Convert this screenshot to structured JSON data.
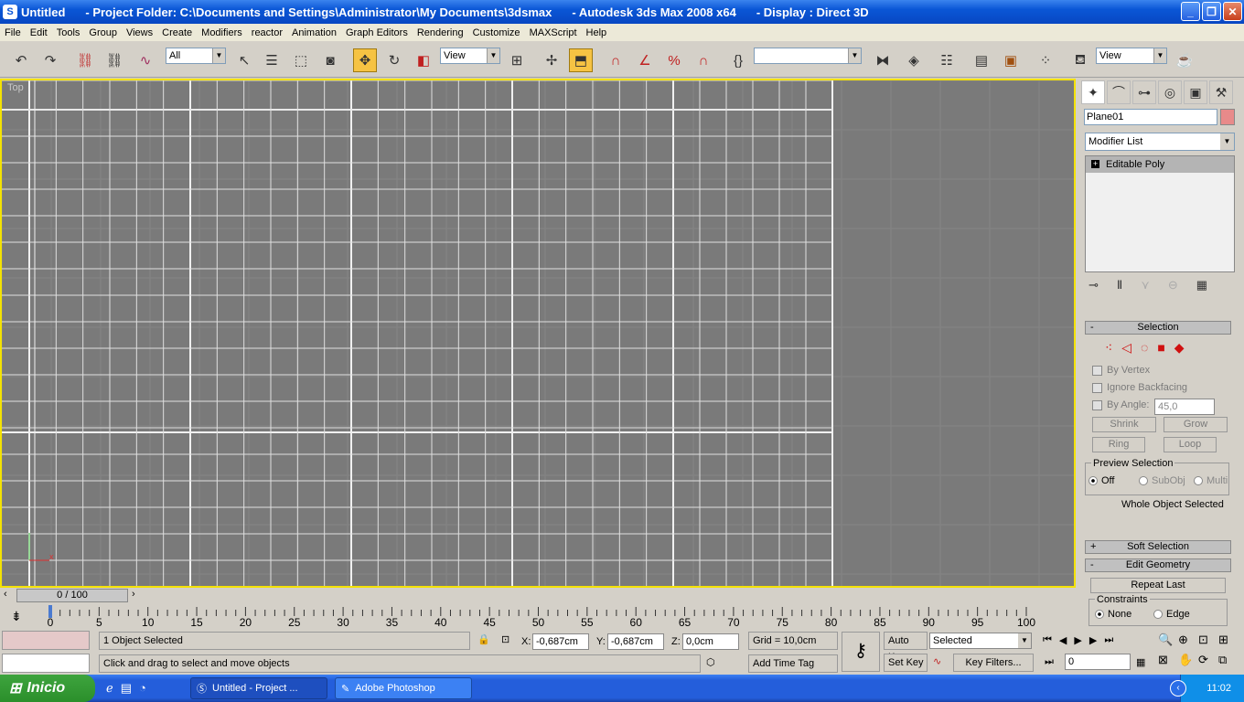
{
  "titlebar": {
    "doc": "Untitled",
    "folder": "- Project Folder: C:\\Documents and Settings\\Administrator\\My Documents\\3dsmax",
    "app": "- Autodesk 3ds Max 2008 x64",
    "display": "- Display : Direct 3D",
    "min": "_",
    "max": "❐",
    "close": "✕"
  },
  "menu": [
    "File",
    "Edit",
    "Tools",
    "Group",
    "Views",
    "Create",
    "Modifiers",
    "reactor",
    "Animation",
    "Graph Editors",
    "Rendering",
    "Customize",
    "MAXScript",
    "Help"
  ],
  "toolbar": {
    "filter": "All",
    "refcoord": "View",
    "selset": "",
    "viewrender": "View"
  },
  "viewport": {
    "label": "Top"
  },
  "cmd": {
    "objname": "Plane01",
    "modlist": "Modifier List",
    "stack_item": "Editable Poly",
    "stack_plus": "+",
    "sel_header": "Selection",
    "sel_sign": "-",
    "by_vertex": "By Vertex",
    "ignore_back": "Ignore Backfacing",
    "by_angle": "By Angle:",
    "angle_val": "45,0",
    "shrink": "Shrink",
    "grow": "Grow",
    "ring": "Ring",
    "loop": "Loop",
    "preview": "Preview Selection",
    "off": "Off",
    "subobj": "SubObj",
    "multi": "Multi",
    "whole": "Whole Object Selected",
    "soft_header": "Soft Selection",
    "soft_sign": "+",
    "edit_geom": "Edit Geometry",
    "edit_sign": "-",
    "repeat": "Repeat Last",
    "constraints": "Constraints",
    "none": "None",
    "edge": "Edge"
  },
  "time": {
    "slider": "0 / 100",
    "ticks": [
      "0",
      "5",
      "10",
      "15",
      "20",
      "25",
      "30",
      "35",
      "40",
      "45",
      "50",
      "55",
      "60",
      "65",
      "70",
      "75",
      "80",
      "85",
      "90",
      "95",
      "100"
    ]
  },
  "status": {
    "selected": "1 Object Selected",
    "prompt": "Click and drag to select and move objects",
    "x_label": "X:",
    "x": "-0,687cm",
    "y_label": "Y:",
    "y": "-0,687cm",
    "z_label": "Z:",
    "z": "0,0cm",
    "grid": "Grid = 10,0cm",
    "autokey": "Auto Key",
    "setkey": "Set Key",
    "keymode": "Selected",
    "keyfilters": "Key Filters...",
    "frame": "0",
    "addtag": "Add Time Tag"
  },
  "taskbar": {
    "start": "Inicio",
    "task1": "Untitled    - Project ...",
    "task2": "Adobe Photoshop",
    "clock": "11:02"
  }
}
